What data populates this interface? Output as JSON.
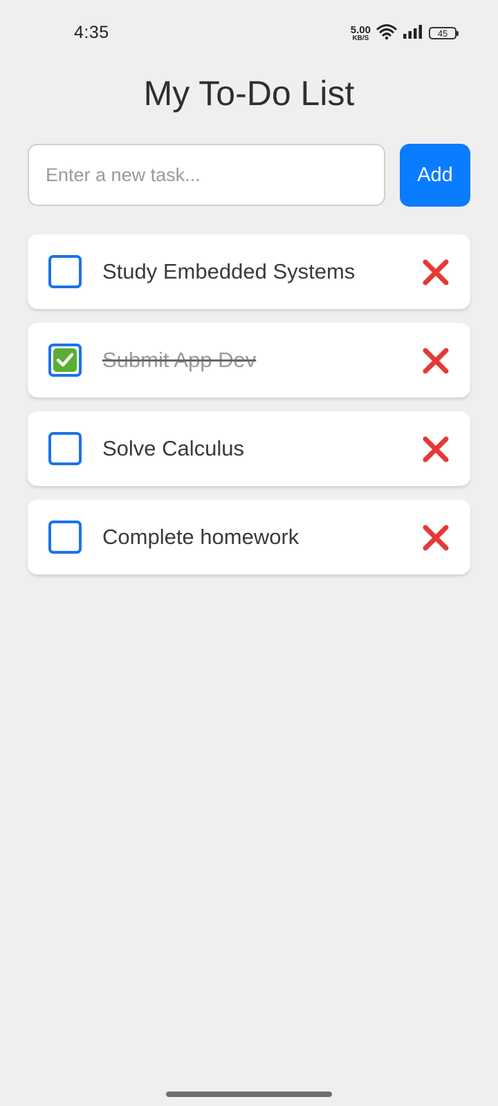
{
  "status_bar": {
    "time": "4:35",
    "net_speed_value": "5.00",
    "net_speed_unit": "KB/S",
    "battery": "45",
    "icons": [
      "wifi-icon",
      "signal-icon",
      "battery-icon"
    ]
  },
  "title": "My To-Do List",
  "input": {
    "placeholder": "Enter a new task...",
    "value": ""
  },
  "add_button_label": "Add",
  "colors": {
    "accent": "#0a7cff",
    "checkbox_border": "#1a73e8",
    "delete": "#e53935",
    "check_fill": "#5aae33"
  },
  "tasks": [
    {
      "label": "Study Embedded Systems",
      "done": false
    },
    {
      "label": "Submit App Dev",
      "done": true
    },
    {
      "label": "Solve Calculus",
      "done": false
    },
    {
      "label": "Complete homework",
      "done": false
    }
  ]
}
